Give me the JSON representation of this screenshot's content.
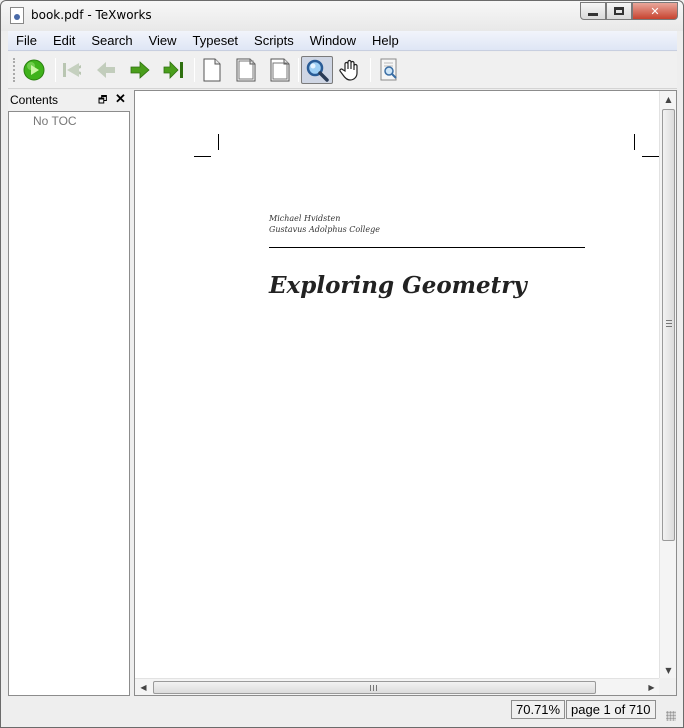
{
  "window": {
    "title": "book.pdf - TeXworks",
    "buttons": {
      "minimize": "minimize",
      "maximize": "maximize",
      "close": "close"
    }
  },
  "menubar": {
    "items": [
      {
        "label": "File"
      },
      {
        "label": "Edit"
      },
      {
        "label": "Search"
      },
      {
        "label": "View"
      },
      {
        "label": "Typeset"
      },
      {
        "label": "Scripts"
      },
      {
        "label": "Window"
      },
      {
        "label": "Help"
      }
    ]
  },
  "toolbar": {
    "buttons": [
      {
        "name": "typeset-play-icon",
        "pressed": false
      },
      {
        "name": "first-page-icon",
        "pressed": false,
        "disabled": true
      },
      {
        "name": "previous-page-icon",
        "pressed": false,
        "disabled": true
      },
      {
        "name": "next-page-icon",
        "pressed": false
      },
      {
        "name": "last-page-icon",
        "pressed": false
      },
      {
        "name": "actual-size-icon",
        "pressed": false
      },
      {
        "name": "fit-width-icon",
        "pressed": false
      },
      {
        "name": "fit-window-icon",
        "pressed": false
      },
      {
        "name": "magnifier-tool-icon",
        "pressed": true
      },
      {
        "name": "hand-scroll-tool-icon",
        "pressed": false
      },
      {
        "name": "goto-source-icon",
        "pressed": false
      }
    ],
    "colors": {
      "play": "#3fb21b",
      "arrow_active": "#4a9e1c",
      "arrow_disabled": "#b9c6b2"
    }
  },
  "contents_panel": {
    "title": "Contents",
    "empty_text": "No TOC"
  },
  "document": {
    "author_name": "Michael Hvidsten",
    "author_affiliation": "Gustavus Adolphus College",
    "title": "Exploring Geometry"
  },
  "status": {
    "zoom": "70.71%",
    "page": "page 1 of 710"
  }
}
